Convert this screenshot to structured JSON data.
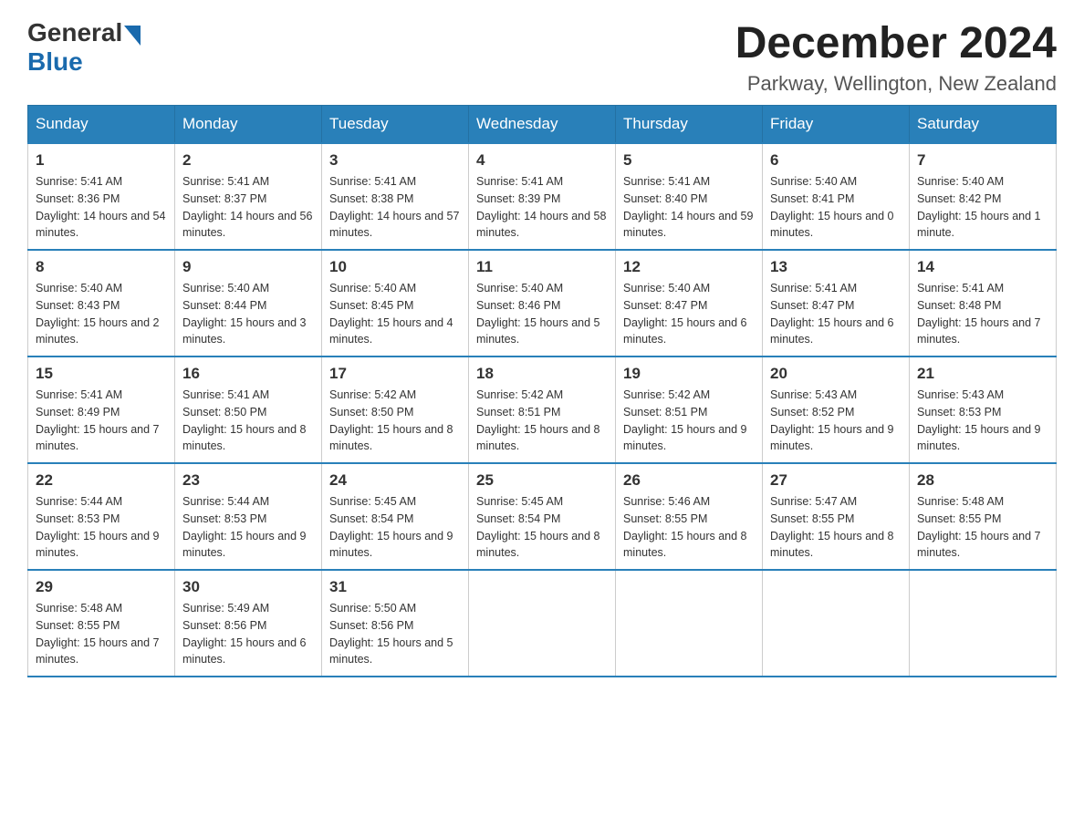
{
  "header": {
    "logo": {
      "general": "General",
      "blue": "Blue"
    },
    "title": "December 2024",
    "subtitle": "Parkway, Wellington, New Zealand"
  },
  "weekdays": [
    "Sunday",
    "Monday",
    "Tuesday",
    "Wednesday",
    "Thursday",
    "Friday",
    "Saturday"
  ],
  "weeks": [
    [
      {
        "day": "1",
        "sunrise": "5:41 AM",
        "sunset": "8:36 PM",
        "daylight": "14 hours and 54 minutes."
      },
      {
        "day": "2",
        "sunrise": "5:41 AM",
        "sunset": "8:37 PM",
        "daylight": "14 hours and 56 minutes."
      },
      {
        "day": "3",
        "sunrise": "5:41 AM",
        "sunset": "8:38 PM",
        "daylight": "14 hours and 57 minutes."
      },
      {
        "day": "4",
        "sunrise": "5:41 AM",
        "sunset": "8:39 PM",
        "daylight": "14 hours and 58 minutes."
      },
      {
        "day": "5",
        "sunrise": "5:41 AM",
        "sunset": "8:40 PM",
        "daylight": "14 hours and 59 minutes."
      },
      {
        "day": "6",
        "sunrise": "5:40 AM",
        "sunset": "8:41 PM",
        "daylight": "15 hours and 0 minutes."
      },
      {
        "day": "7",
        "sunrise": "5:40 AM",
        "sunset": "8:42 PM",
        "daylight": "15 hours and 1 minute."
      }
    ],
    [
      {
        "day": "8",
        "sunrise": "5:40 AM",
        "sunset": "8:43 PM",
        "daylight": "15 hours and 2 minutes."
      },
      {
        "day": "9",
        "sunrise": "5:40 AM",
        "sunset": "8:44 PM",
        "daylight": "15 hours and 3 minutes."
      },
      {
        "day": "10",
        "sunrise": "5:40 AM",
        "sunset": "8:45 PM",
        "daylight": "15 hours and 4 minutes."
      },
      {
        "day": "11",
        "sunrise": "5:40 AM",
        "sunset": "8:46 PM",
        "daylight": "15 hours and 5 minutes."
      },
      {
        "day": "12",
        "sunrise": "5:40 AM",
        "sunset": "8:47 PM",
        "daylight": "15 hours and 6 minutes."
      },
      {
        "day": "13",
        "sunrise": "5:41 AM",
        "sunset": "8:47 PM",
        "daylight": "15 hours and 6 minutes."
      },
      {
        "day": "14",
        "sunrise": "5:41 AM",
        "sunset": "8:48 PM",
        "daylight": "15 hours and 7 minutes."
      }
    ],
    [
      {
        "day": "15",
        "sunrise": "5:41 AM",
        "sunset": "8:49 PM",
        "daylight": "15 hours and 7 minutes."
      },
      {
        "day": "16",
        "sunrise": "5:41 AM",
        "sunset": "8:50 PM",
        "daylight": "15 hours and 8 minutes."
      },
      {
        "day": "17",
        "sunrise": "5:42 AM",
        "sunset": "8:50 PM",
        "daylight": "15 hours and 8 minutes."
      },
      {
        "day": "18",
        "sunrise": "5:42 AM",
        "sunset": "8:51 PM",
        "daylight": "15 hours and 8 minutes."
      },
      {
        "day": "19",
        "sunrise": "5:42 AM",
        "sunset": "8:51 PM",
        "daylight": "15 hours and 9 minutes."
      },
      {
        "day": "20",
        "sunrise": "5:43 AM",
        "sunset": "8:52 PM",
        "daylight": "15 hours and 9 minutes."
      },
      {
        "day": "21",
        "sunrise": "5:43 AM",
        "sunset": "8:53 PM",
        "daylight": "15 hours and 9 minutes."
      }
    ],
    [
      {
        "day": "22",
        "sunrise": "5:44 AM",
        "sunset": "8:53 PM",
        "daylight": "15 hours and 9 minutes."
      },
      {
        "day": "23",
        "sunrise": "5:44 AM",
        "sunset": "8:53 PM",
        "daylight": "15 hours and 9 minutes."
      },
      {
        "day": "24",
        "sunrise": "5:45 AM",
        "sunset": "8:54 PM",
        "daylight": "15 hours and 9 minutes."
      },
      {
        "day": "25",
        "sunrise": "5:45 AM",
        "sunset": "8:54 PM",
        "daylight": "15 hours and 8 minutes."
      },
      {
        "day": "26",
        "sunrise": "5:46 AM",
        "sunset": "8:55 PM",
        "daylight": "15 hours and 8 minutes."
      },
      {
        "day": "27",
        "sunrise": "5:47 AM",
        "sunset": "8:55 PM",
        "daylight": "15 hours and 8 minutes."
      },
      {
        "day": "28",
        "sunrise": "5:48 AM",
        "sunset": "8:55 PM",
        "daylight": "15 hours and 7 minutes."
      }
    ],
    [
      {
        "day": "29",
        "sunrise": "5:48 AM",
        "sunset": "8:55 PM",
        "daylight": "15 hours and 7 minutes."
      },
      {
        "day": "30",
        "sunrise": "5:49 AM",
        "sunset": "8:56 PM",
        "daylight": "15 hours and 6 minutes."
      },
      {
        "day": "31",
        "sunrise": "5:50 AM",
        "sunset": "8:56 PM",
        "daylight": "15 hours and 5 minutes."
      },
      null,
      null,
      null,
      null
    ]
  ],
  "labels": {
    "sunrise": "Sunrise:",
    "sunset": "Sunset:",
    "daylight": "Daylight:"
  }
}
